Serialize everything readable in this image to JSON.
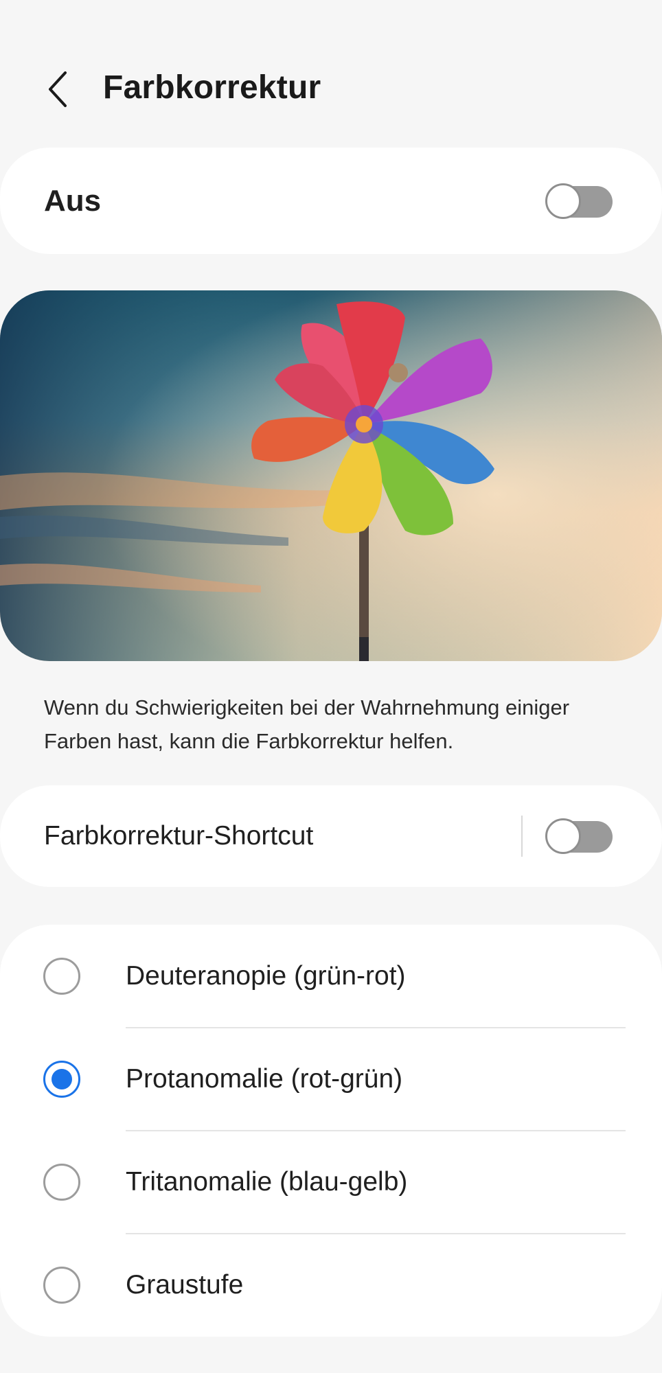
{
  "header": {
    "title": "Farbkorrektur",
    "back_icon": "chevron-left-icon"
  },
  "master_switch": {
    "label": "Aus",
    "checked": false
  },
  "preview": {
    "subject": "pinwheel"
  },
  "description": "Wenn du Schwierigkeiten bei der Wahrnehmung einiger Farben hast, kann die Farbkorrektur helfen.",
  "shortcut": {
    "label": "Farbkorrektur-Shortcut",
    "checked": false
  },
  "options": {
    "selected_index": 1,
    "items": [
      {
        "label": "Deuteranopie (grün-rot)",
        "selected": false
      },
      {
        "label": "Protanomalie (rot-grün)",
        "selected": true
      },
      {
        "label": "Tritanomalie (blau-gelb)",
        "selected": false
      },
      {
        "label": "Graustufe",
        "selected": false
      }
    ]
  },
  "colors": {
    "accent": "#1a73e8",
    "background": "#f6f6f6",
    "card": "#ffffff",
    "toggle_off_track": "#9a9a9a"
  }
}
